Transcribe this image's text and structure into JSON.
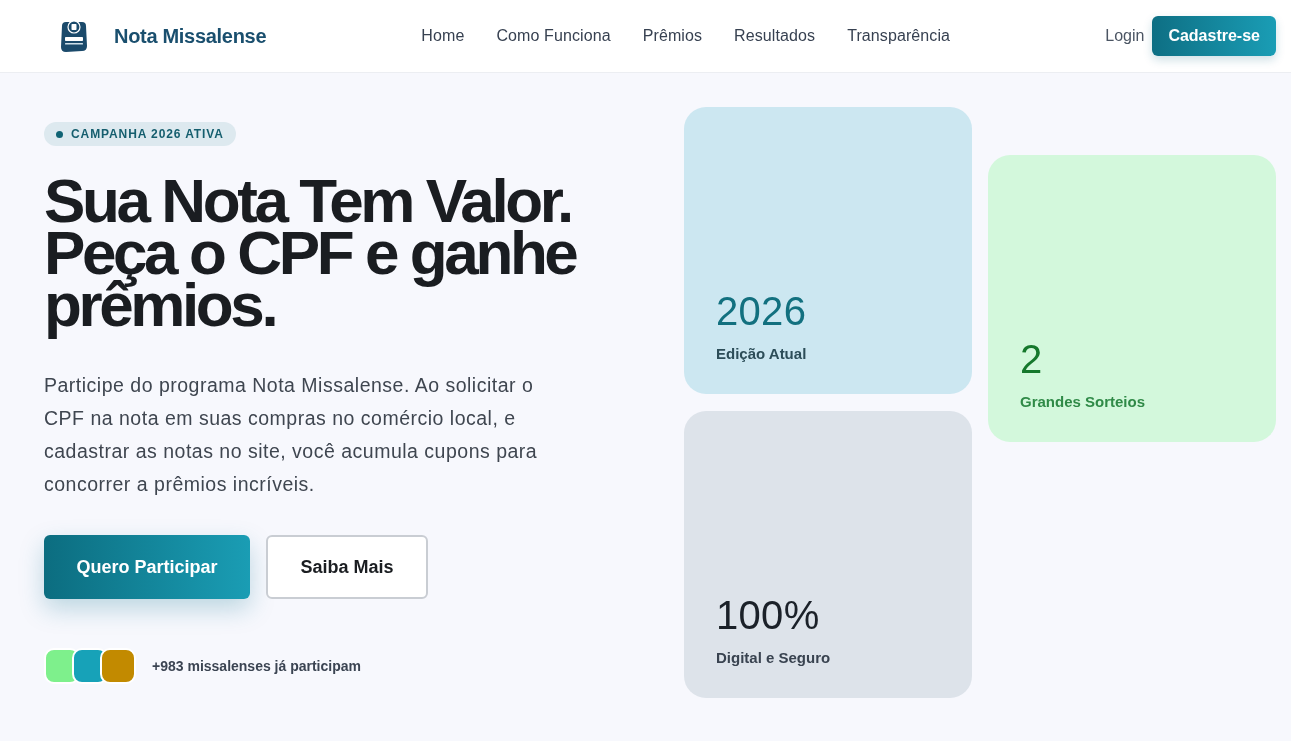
{
  "header": {
    "brand": "Nota Missalense",
    "nav": [
      "Home",
      "Como Funciona",
      "Prêmios",
      "Resultados",
      "Transparência"
    ],
    "login": "Login",
    "signup": "Cadastre-se"
  },
  "hero": {
    "badge": "CAMPANHA 2026 ATIVA",
    "title": "Sua Nota Tem Valor. Peça o CPF e ganhe **prêmios**.",
    "description": "Participe do programa Nota Missalense. Ao solicitar o CPF na nota em suas compras no comércio local, e cadastrar as notas no site, você acumula cupons para concorrer a prêmios incríveis.",
    "primary_button": "Quero Participar",
    "secondary_button": "Saiba Mais",
    "participants": {
      "avatars": [
        {
          "color": "#7ef08c"
        },
        {
          "color": "#17a2b8"
        },
        {
          "color": "#c28a00"
        }
      ],
      "text": "**+983** missalenses já participam"
    }
  },
  "stats": [
    {
      "value": "2026",
      "label": "Edição Atual",
      "color": "#cce7f1"
    },
    {
      "value": "2",
      "label": "Grandes Sorteios",
      "color": "#d3f8dc"
    },
    {
      "value": "100%",
      "label": "Digital e Seguro",
      "color": "#dde3ea"
    }
  ]
}
